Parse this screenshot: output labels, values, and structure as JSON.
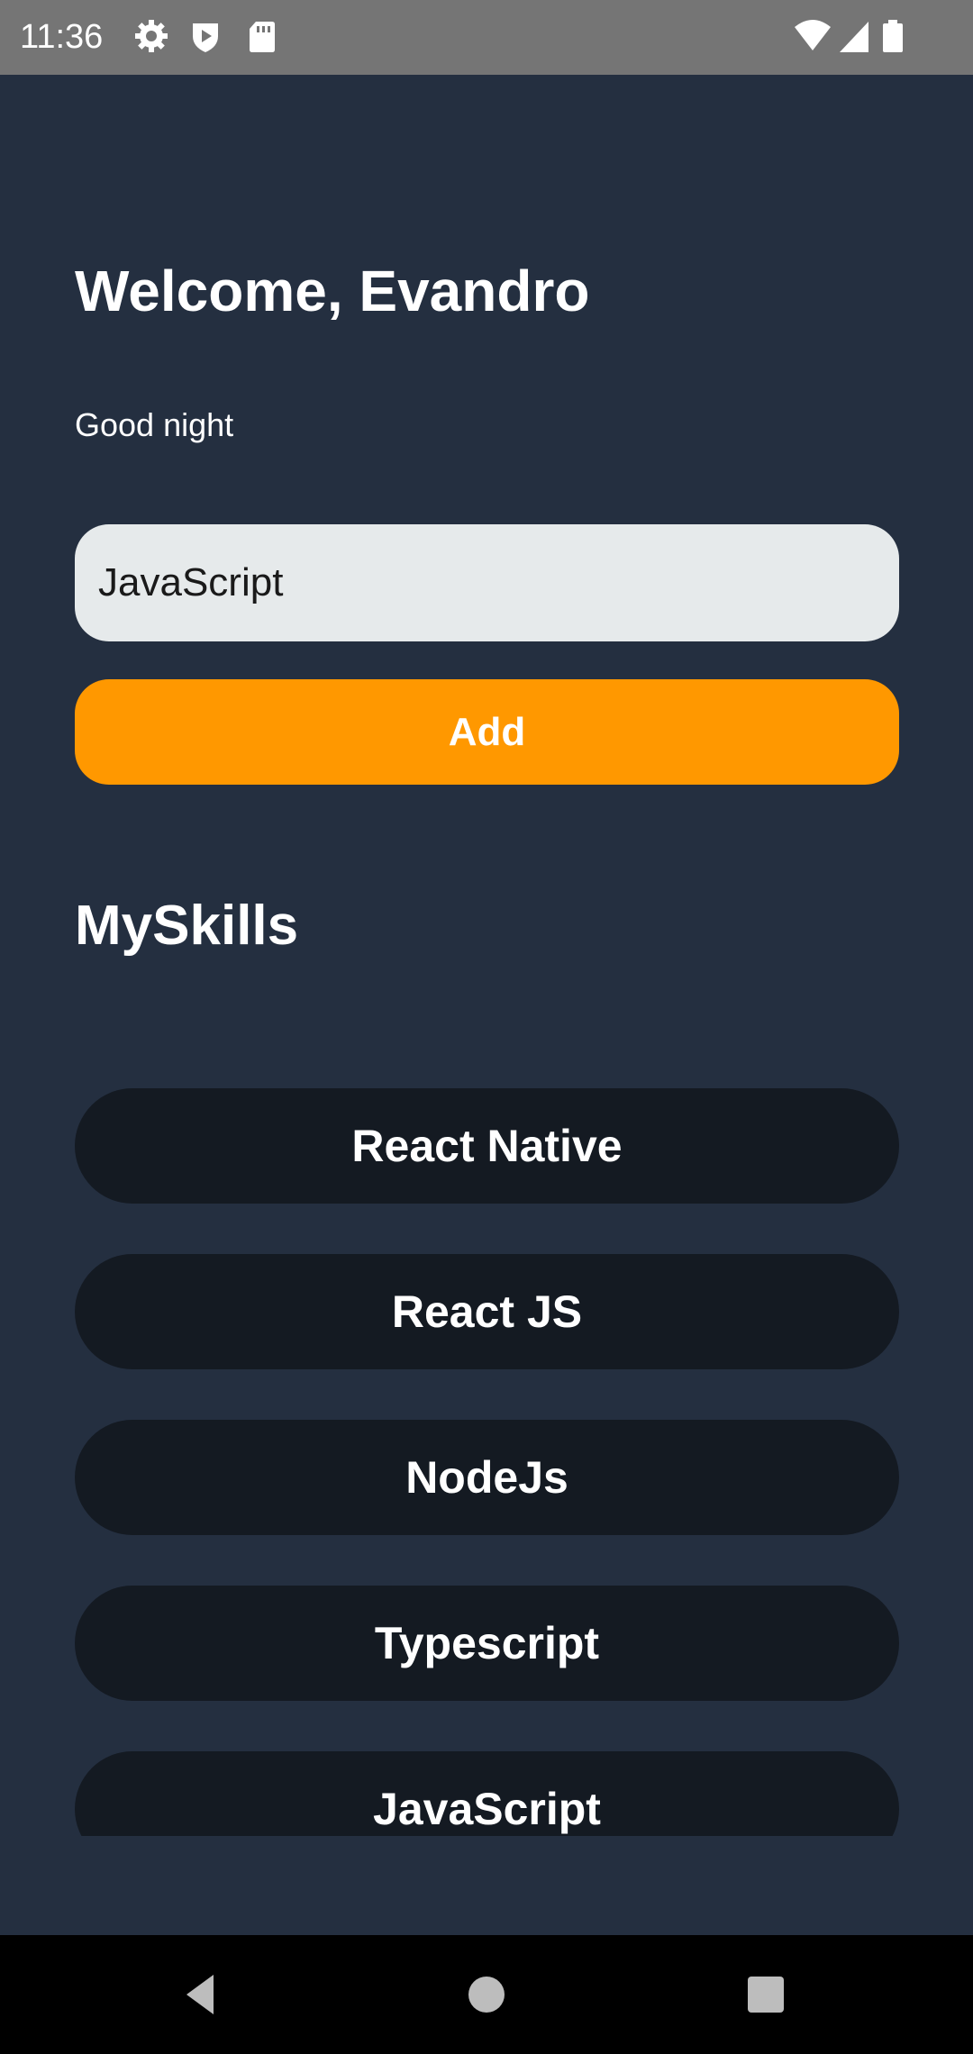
{
  "status_bar": {
    "time": "11:36",
    "icons": [
      "gear-icon",
      "shield-play-icon",
      "sd-card-icon",
      "wifi-icon",
      "cellular-signal-icon",
      "battery-icon"
    ]
  },
  "header": {
    "title": "Welcome, Evandro",
    "greeting": "Good night"
  },
  "skill_input": {
    "value": "JavaScript",
    "placeholder": ""
  },
  "add_button": {
    "label": "Add",
    "color": "#ff9800"
  },
  "skills_section": {
    "title": "MySkills",
    "items": [
      {
        "label": "React Native"
      },
      {
        "label": "React JS"
      },
      {
        "label": "NodeJs"
      },
      {
        "label": "Typescript"
      },
      {
        "label": "JavaScript"
      }
    ]
  },
  "colors": {
    "background": "#242f40",
    "card": "#141a22",
    "input": "#e6eaeb",
    "accent": "#ff9800"
  },
  "navigation": {
    "icons": [
      "back-icon",
      "home-icon",
      "recents-icon"
    ]
  }
}
